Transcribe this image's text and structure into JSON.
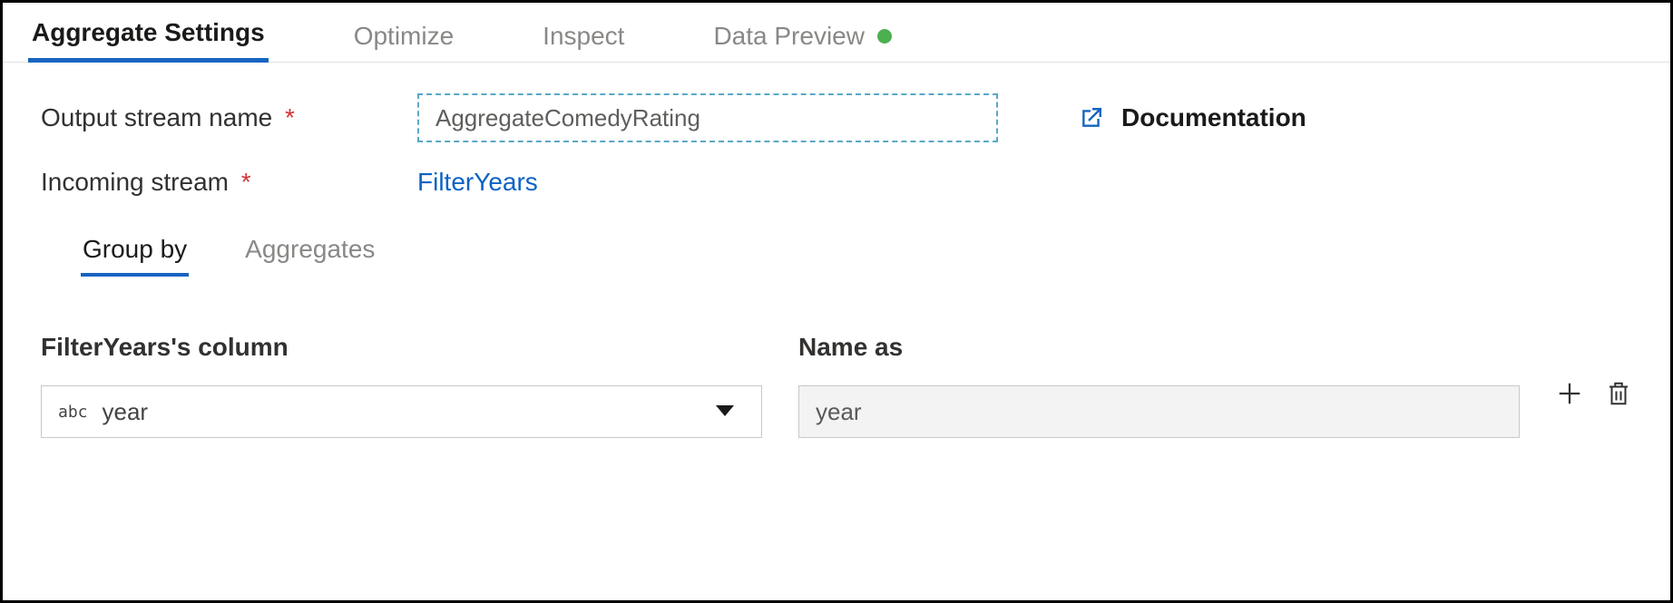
{
  "tabs": {
    "aggregate_settings": "Aggregate Settings",
    "optimize": "Optimize",
    "inspect": "Inspect",
    "data_preview": "Data Preview"
  },
  "form": {
    "output_stream_label": "Output stream name",
    "output_stream_value": "AggregateComedyRating",
    "incoming_stream_label": "Incoming stream",
    "incoming_stream_value": "FilterYears",
    "documentation_label": "Documentation"
  },
  "subtabs": {
    "group_by": "Group by",
    "aggregates": "Aggregates"
  },
  "columns": {
    "source_header": "FilterYears's column",
    "name_as_header": "Name as",
    "type_badge": "abc",
    "source_value": "year",
    "name_as_value": "year"
  }
}
